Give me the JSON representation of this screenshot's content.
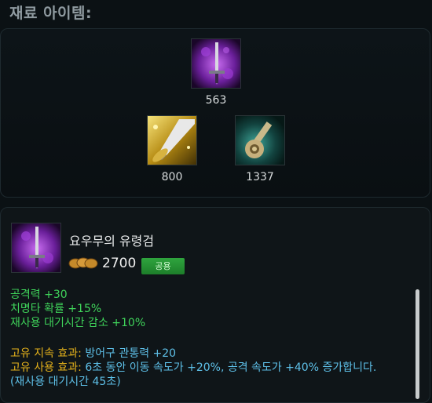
{
  "header": {
    "title": "재료 아이템:"
  },
  "recipe": {
    "top_item": {
      "name": "sword-purple-icon",
      "cost": "563"
    },
    "components": [
      {
        "name": "sword-gold-icon",
        "cost": "800"
      },
      {
        "name": "hilt-green-icon",
        "cost": "1337"
      }
    ]
  },
  "item": {
    "name": "요우무의 유령검",
    "price": "2700",
    "map_badge": "공용",
    "stats": [
      "공격력 +30",
      "치명타 확률 +15%",
      "재사용 대기시간 감소 +10%"
    ],
    "passive_label": "고유 지속 효과:",
    "passive_text": " 방어구 관통력 +20",
    "active_label": "고유 사용 효과:",
    "active_text": " 6초 동안 이동 속도가 +20%, 공격 속도가 +40% 증가합니다.",
    "active_cooldown": "(재사용 대기시간 45초)"
  },
  "colors": {
    "stat_green": "#3fd35a",
    "label_gold": "#e5b21b",
    "effect_blue": "#5ec0e8",
    "badge_green": "#2fa53e"
  }
}
